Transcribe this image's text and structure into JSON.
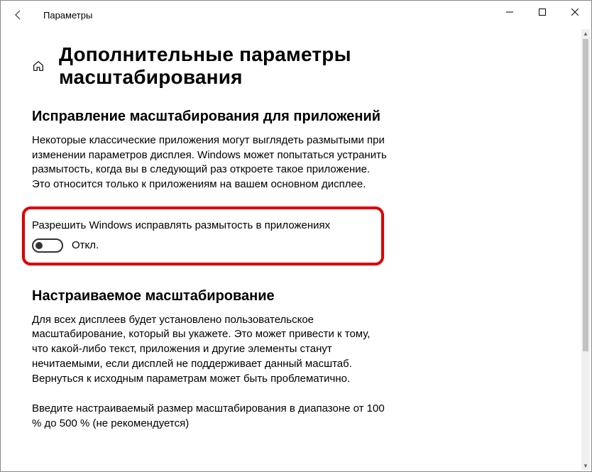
{
  "window": {
    "title": "Параметры"
  },
  "page": {
    "title": "Дополнительные параметры масштабирования"
  },
  "section_fix": {
    "heading": "Исправление масштабирования для приложений",
    "description": "Некоторые классические приложения могут выглядеть размытыми при изменении параметров дисплея. Windows может попытаться устранить размытость, когда вы в следующий раз откроете такое приложение. Это относится только к приложениям на вашем основном дисплее.",
    "toggle_label": "Разрешить Windows исправлять размытость в приложениях",
    "toggle_state": "Откл."
  },
  "section_custom": {
    "heading": "Настраиваемое масштабирование",
    "description": "Для всех дисплеев будет установлено пользовательское масштабирование, который вы укажете. Это может привести к тому, что какой-либо текст, приложения и другие элементы станут нечитаемыми, если дисплей не поддерживает данный масштаб. Вернуться к исходным параметрам может быть проблематично.",
    "input_hint": "Введите настраиваемый размер масштабирования в диапазоне от 100 % до 500 % (не рекомендуется)"
  }
}
